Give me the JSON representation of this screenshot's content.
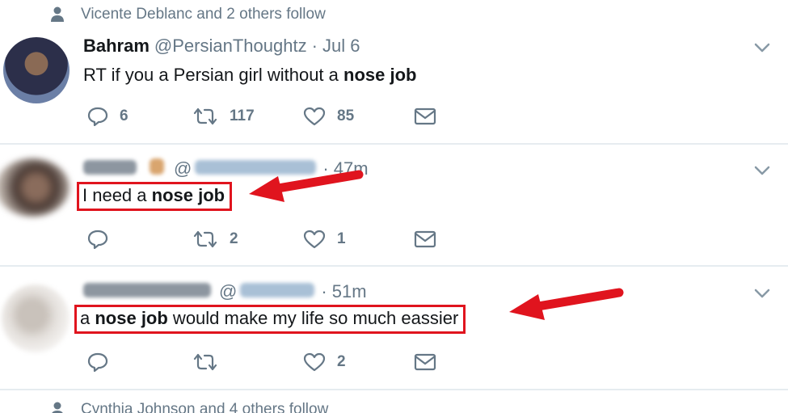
{
  "top_context": {
    "text": "Vicente Deblanc and 2 others follow"
  },
  "bottom_context": {
    "text": "Cynthia Johnson and 4 others follow"
  },
  "tweets": [
    {
      "name": "Bahram",
      "handle": "@PersianThoughtz",
      "time": "· Jul 6",
      "body_plain": "RT if you a Persian girl without a ",
      "body_bold": "nose job",
      "replies": "6",
      "retweets": "117",
      "likes": "85"
    },
    {
      "name_redacted": true,
      "handle": "@",
      "time": "· 47m",
      "body_plain": "I need a ",
      "body_bold": "nose job",
      "replies": "",
      "retweets": "2",
      "likes": "1"
    },
    {
      "name_redacted": true,
      "handle": "@",
      "time": "· 51m",
      "body_prefix": "a ",
      "body_bold": "nose job",
      "body_suffix": " would make my life so much eassier",
      "replies": "",
      "retweets": "",
      "likes": "2"
    }
  ],
  "colors": {
    "highlight_red": "#e0141e",
    "muted": "#657786",
    "text": "#14171a"
  },
  "icons": [
    "person-icon",
    "reply-icon",
    "retweet-icon",
    "like-icon",
    "message-icon",
    "chevron-down-icon",
    "red-arrow-icon"
  ]
}
